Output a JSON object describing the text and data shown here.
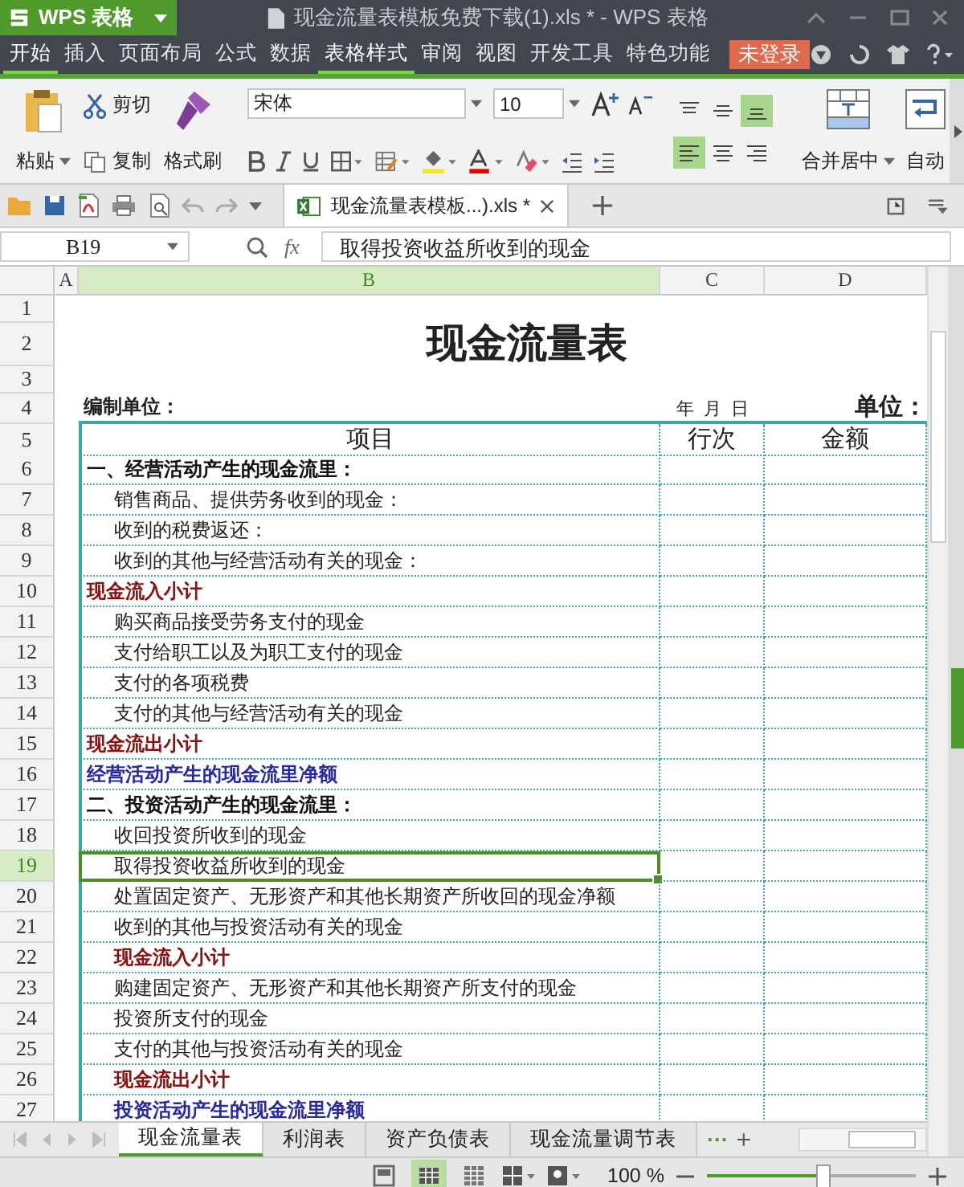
{
  "title_bar": {
    "app_button": "WPS 表格",
    "title": "现金流量表模板免费下载(1).xls * - WPS 表格"
  },
  "menu": [
    {
      "label": "开始",
      "selected": true
    },
    {
      "label": "插入",
      "selected": false
    },
    {
      "label": "页面布局",
      "selected": false
    },
    {
      "label": "公式",
      "selected": false
    },
    {
      "label": "数据",
      "selected": false
    },
    {
      "label": "表格样式",
      "selected": true
    },
    {
      "label": "审阅",
      "selected": false
    },
    {
      "label": "视图",
      "selected": false
    },
    {
      "label": "开发工具",
      "selected": false
    },
    {
      "label": "特色功能",
      "selected": false
    }
  ],
  "login_button": "未登录",
  "ribbon": {
    "paste": "粘贴",
    "cut": "剪切",
    "copy": "复制",
    "format_painter": "格式刷",
    "font": "宋体",
    "font_size": "10",
    "align_buttons": [
      {
        "kind": "top",
        "selected": false
      },
      {
        "kind": "middle",
        "selected": false
      },
      {
        "kind": "bottom",
        "selected": true
      },
      {
        "kind": "left",
        "selected": true
      },
      {
        "kind": "center",
        "selected": false
      },
      {
        "kind": "right",
        "selected": false
      }
    ],
    "merge": "合并居中",
    "wrap": "自动"
  },
  "doc_tab": "现金流量表模板...).xls *",
  "name_box": "B19",
  "fx": "fx",
  "formula": "取得投资收益所收到的现金",
  "columns": [
    {
      "label": "A",
      "selected": false
    },
    {
      "label": "B",
      "selected": true
    },
    {
      "label": "C",
      "selected": false
    },
    {
      "label": "D",
      "selected": false
    }
  ],
  "top_rows": [
    {
      "num": "1",
      "kind": "blank"
    },
    {
      "num": "2",
      "kind": "title",
      "cells": [
        "现金流量表"
      ]
    },
    {
      "num": "3",
      "kind": "blank"
    },
    {
      "num": "4",
      "kind": "info",
      "cells": [
        "编制单位：",
        "年  月  日",
        "单位："
      ]
    }
  ],
  "header_row": {
    "num": "5",
    "cells": [
      "项目",
      "行次",
      "金额"
    ]
  },
  "rows": [
    {
      "num": "6",
      "text": "一、经营活动产生的现金流里：",
      "kind": "section",
      "indented": false,
      "selected": false
    },
    {
      "num": "7",
      "text": "销售商品、提供劳务收到的现金：",
      "kind": "item",
      "indented": true,
      "selected": false
    },
    {
      "num": "8",
      "text": "收到的税费返还：",
      "kind": "item",
      "indented": true,
      "selected": false
    },
    {
      "num": "9",
      "text": "收到的其他与经营活动有关的现金：",
      "kind": "item",
      "indented": true,
      "selected": false
    },
    {
      "num": "10",
      "text": "现金流入小计",
      "kind": "subtotal",
      "indented": false,
      "selected": false
    },
    {
      "num": "11",
      "text": "购买商品接受劳务支付的现金",
      "kind": "item",
      "indented": true,
      "selected": false
    },
    {
      "num": "12",
      "text": "支付给职工以及为职工支付的现金",
      "kind": "item",
      "indented": true,
      "selected": false
    },
    {
      "num": "13",
      "text": "支付的各项税费",
      "kind": "item",
      "indented": true,
      "selected": false
    },
    {
      "num": "14",
      "text": "支付的其他与经营活动有关的现金",
      "kind": "item",
      "indented": true,
      "selected": false
    },
    {
      "num": "15",
      "text": "现金流出小计",
      "kind": "subtotal",
      "indented": false,
      "selected": false
    },
    {
      "num": "16",
      "text": "经营活动产生的现金流里净额",
      "kind": "net",
      "indented": false,
      "selected": false
    },
    {
      "num": "17",
      "text": "二、投资活动产生的现金流里：",
      "kind": "section",
      "indented": false,
      "selected": false
    },
    {
      "num": "18",
      "text": "收回投资所收到的现金",
      "kind": "item",
      "indented": true,
      "selected": false
    },
    {
      "num": "19",
      "text": "取得投资收益所收到的现金",
      "kind": "item",
      "indented": true,
      "selected": true
    },
    {
      "num": "20",
      "text": "处置固定资产、无形资产和其他长期资产所收回的现金净额",
      "kind": "item",
      "indented": true,
      "selected": false
    },
    {
      "num": "21",
      "text": "收到的其他与投资活动有关的现金",
      "kind": "item",
      "indented": true,
      "selected": false
    },
    {
      "num": "22",
      "text": "现金流入小计",
      "kind": "subtotal",
      "indented": true,
      "selected": false
    },
    {
      "num": "23",
      "text": "购建固定资产、无形资产和其他长期资产所支付的现金",
      "kind": "item",
      "indented": true,
      "selected": false
    },
    {
      "num": "24",
      "text": "投资所支付的现金",
      "kind": "item",
      "indented": true,
      "selected": false
    },
    {
      "num": "25",
      "text": "支付的其他与投资活动有关的现金",
      "kind": "item",
      "indented": true,
      "selected": false
    },
    {
      "num": "26",
      "text": "现金流出小计",
      "kind": "subtotal",
      "indented": true,
      "selected": false
    },
    {
      "num": "27",
      "text": "投资活动产生的现金流里净额",
      "kind": "net",
      "indented": true,
      "selected": false
    }
  ],
  "sheet_tabs": [
    {
      "label": "现金流量表",
      "selected": true
    },
    {
      "label": "利润表",
      "selected": false
    },
    {
      "label": "资产负债表",
      "selected": false
    },
    {
      "label": "现金流量调节表",
      "selected": false
    }
  ],
  "more_tabs": "···",
  "views": [
    {
      "kind": "reading",
      "selected": false
    },
    {
      "kind": "normal",
      "selected": true
    },
    {
      "kind": "page",
      "selected": false
    }
  ],
  "zoom": {
    "label": "100 %",
    "level": 0.55
  }
}
